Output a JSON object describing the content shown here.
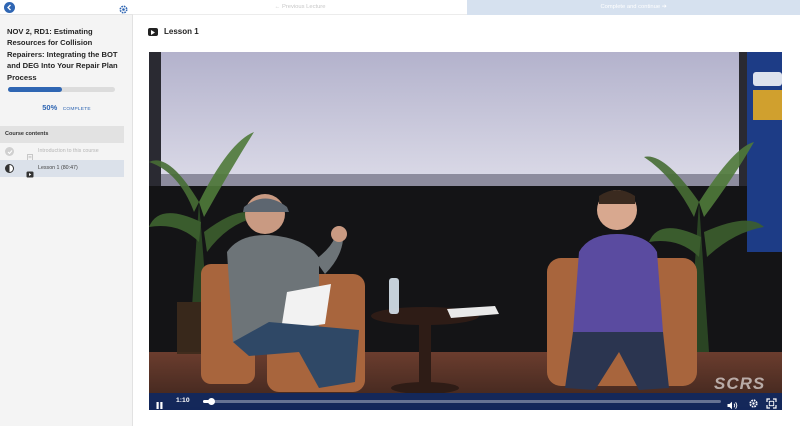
{
  "sidebar": {
    "course_title": "NOV 2, RD1: Estimating Resources for Collision Repairers: Integrating the BOT and DEG Into Your Repair Plan Process",
    "progress_percent": 50,
    "progress_text": "50%",
    "progress_word": "COMPLETE",
    "contents_header": "Course contents",
    "items": [
      {
        "label": "Introduction to this course",
        "status": "complete",
        "icon": "document-icon"
      },
      {
        "label": "Lesson 1 (80:47)",
        "status": "in-progress",
        "icon": "video-icon"
      }
    ]
  },
  "topbar": {
    "prev_label": "Previous Lecture",
    "next_label": "Complete and continue"
  },
  "lesson": {
    "title": "Lesson 1"
  },
  "player": {
    "current_time": "1:10",
    "played_fraction": 0.014,
    "watermark": "SCRS",
    "accent_color": "#10285f"
  },
  "colors": {
    "brand": "#2f66b3",
    "next_button_bg": "#d6e1ef"
  }
}
